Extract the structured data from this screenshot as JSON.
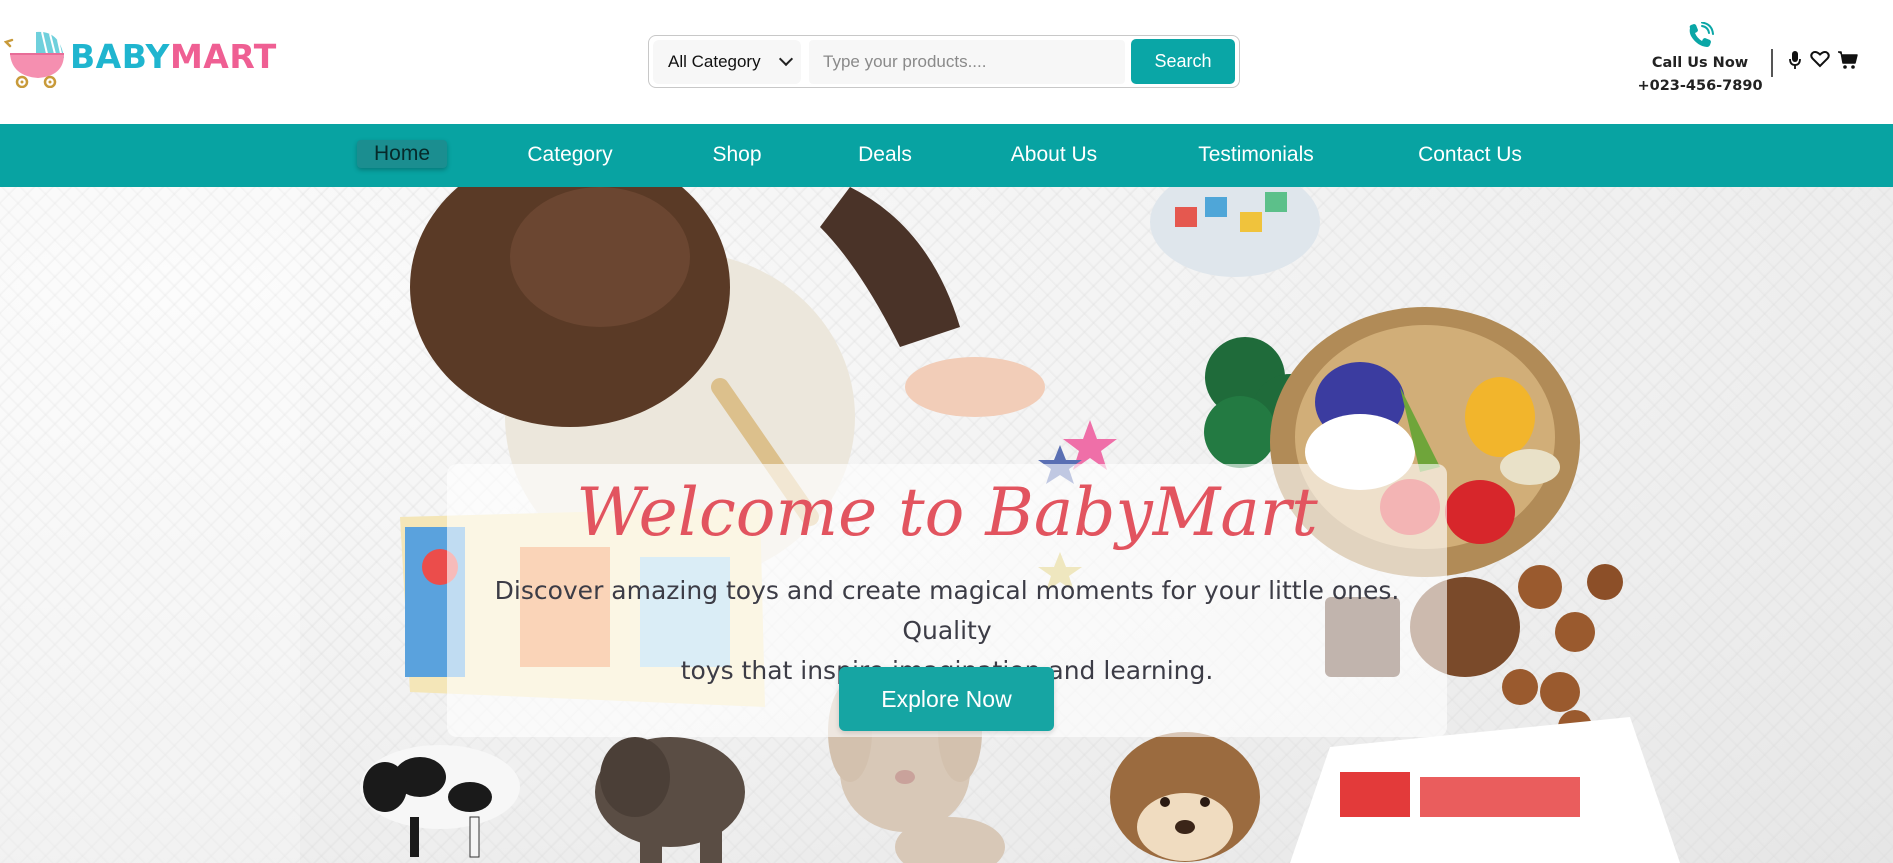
{
  "logo": {
    "part1": "BABY",
    "part2": "MART"
  },
  "search": {
    "category_selected": "All Category",
    "placeholder": "Type your products....",
    "button_label": "Search"
  },
  "contact": {
    "label": "Call Us Now",
    "number": "+023-456-7890"
  },
  "header_icons": [
    "microphone-icon",
    "heart-icon",
    "cart-icon"
  ],
  "nav": {
    "items": [
      {
        "label": "Home",
        "active": true
      },
      {
        "label": "Category"
      },
      {
        "label": "Shop"
      },
      {
        "label": "Deals"
      },
      {
        "label": "About Us"
      },
      {
        "label": "Testimonials"
      },
      {
        "label": "Contact Us"
      }
    ]
  },
  "hero": {
    "title": "Welcome to BabyMart",
    "tagline_line1": "Discover amazing toys and create magical moments for your little ones. Quality",
    "tagline_line2": "toys that inspire imagination and learning.",
    "cta_label": "Explore Now"
  },
  "colors": {
    "primary_teal": "#08a3a2",
    "logo_blue": "#1fb5cf",
    "logo_pink": "#ef5f93",
    "title_red": "#e2545f"
  }
}
